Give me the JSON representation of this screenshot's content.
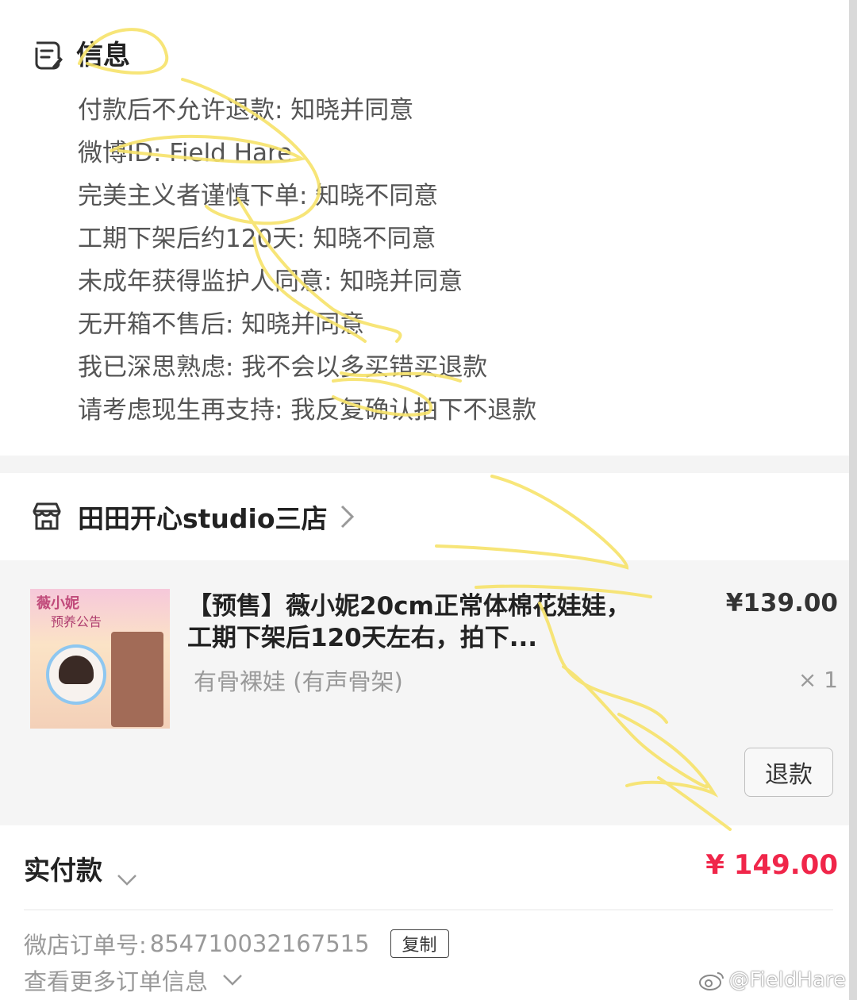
{
  "info": {
    "title": "信息",
    "lines": [
      "付款后不允许退款: 知晓并同意",
      "微博ID: Field Hare",
      "完美主义者谨慎下单: 知晓不同意",
      "工期下架后约120天: 知晓不同意",
      "未成年获得监护人同意: 知晓并同意",
      "无开箱不售后: 知晓并同意",
      "我已深思熟虑: 我不会以多买错买退款",
      "请考虑现生再支持: 我反复确认拍下不退款"
    ]
  },
  "store": {
    "name": "田田开心studio三店"
  },
  "item": {
    "thumb_title": "薇小妮",
    "thumb_sub": "预养公告",
    "title": "【预售】薇小妮20cm正常体棉花娃娃，工期下架后120天左右，拍下...",
    "price": "¥139.00",
    "variant": "有骨裸娃 (有声骨架)",
    "quantity": "× 1",
    "refund_label": "退款"
  },
  "payment": {
    "label": "实付款",
    "amount": "¥ 149.00"
  },
  "order": {
    "number_label": "微店订单号:",
    "number": "854710032167515",
    "copy_label": "复制",
    "more_label": "查看更多订单信息"
  },
  "watermark": {
    "text": "@FieldHare"
  },
  "colors": {
    "price_red": "#f0264a",
    "highlighter": "#f7e36a",
    "card_bg": "#f5f5f5"
  }
}
